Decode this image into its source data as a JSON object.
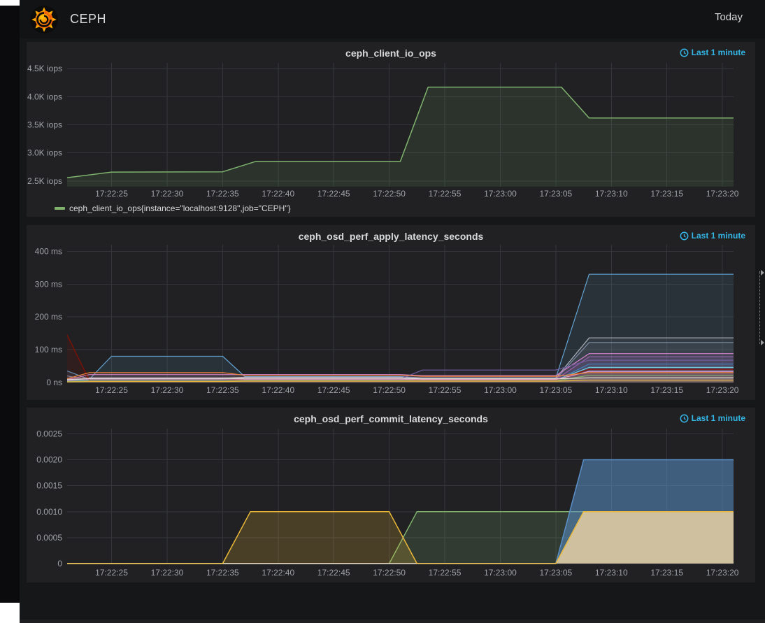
{
  "header": {
    "title": "CEPH",
    "time_picker": "Today"
  },
  "panels": [
    {
      "title": "ceph_client_io_ops",
      "time_range": "Last 1 minute"
    },
    {
      "title": "ceph_osd_perf_apply_latency_seconds",
      "time_range": "Last 1 minute"
    },
    {
      "title": "ceph_osd_perf_commit_latency_seconds",
      "time_range": "Last 1 minute"
    }
  ],
  "colors": {
    "accent_blue": "#33b5e5",
    "panel_bg": "#212124",
    "page_bg": "#161719",
    "series_green": "#7EB26D"
  },
  "chart_data": [
    {
      "type": "area",
      "title": "ceph_client_io_ops",
      "xlabel": "time",
      "ylabel": "iops",
      "xlim": [
        21,
        81
      ],
      "ylim": [
        2400,
        4600
      ],
      "grid": true,
      "legend_position": "bottom-left",
      "xticks": [
        {
          "v": 25,
          "label": "17:22:25"
        },
        {
          "v": 30,
          "label": "17:22:30"
        },
        {
          "v": 35,
          "label": "17:22:35"
        },
        {
          "v": 40,
          "label": "17:22:40"
        },
        {
          "v": 45,
          "label": "17:22:45"
        },
        {
          "v": 50,
          "label": "17:22:50"
        },
        {
          "v": 55,
          "label": "17:22:55"
        },
        {
          "v": 60,
          "label": "17:23:00"
        },
        {
          "v": 65,
          "label": "17:23:05"
        },
        {
          "v": 70,
          "label": "17:23:10"
        },
        {
          "v": 75,
          "label": "17:23:15"
        },
        {
          "v": 80,
          "label": "17:23:20"
        }
      ],
      "yticks": [
        {
          "v": 2500,
          "label": "2.5K iops"
        },
        {
          "v": 3000,
          "label": "3.0K iops"
        },
        {
          "v": 3500,
          "label": "3.5K iops"
        },
        {
          "v": 4000,
          "label": "4.0K iops"
        },
        {
          "v": 4500,
          "label": "4.5K iops"
        }
      ],
      "series": [
        {
          "name": "ceph_client_io_ops{instance=\"localhost:9128\",job=\"CEPH\"}",
          "color": "#7EB26D",
          "fill_opacity": 0.12,
          "points": [
            [
              21,
              2560
            ],
            [
              25,
              2660
            ],
            [
              35,
              2665
            ],
            [
              38,
              2850
            ],
            [
              51,
              2850
            ],
            [
              53.5,
              4170
            ],
            [
              65.5,
              4170
            ],
            [
              68,
              3620
            ],
            [
              81,
              3620
            ]
          ]
        }
      ]
    },
    {
      "type": "area",
      "title": "ceph_osd_perf_apply_latency_seconds",
      "xlabel": "time",
      "ylabel": "latency",
      "xlim": [
        21,
        81
      ],
      "ylim": [
        0,
        420
      ],
      "grid": true,
      "xticks": [
        {
          "v": 25,
          "label": "17:22:25"
        },
        {
          "v": 30,
          "label": "17:22:30"
        },
        {
          "v": 35,
          "label": "17:22:35"
        },
        {
          "v": 40,
          "label": "17:22:40"
        },
        {
          "v": 45,
          "label": "17:22:45"
        },
        {
          "v": 50,
          "label": "17:22:50"
        },
        {
          "v": 55,
          "label": "17:22:55"
        },
        {
          "v": 60,
          "label": "17:23:00"
        },
        {
          "v": 65,
          "label": "17:23:05"
        },
        {
          "v": 70,
          "label": "17:23:10"
        },
        {
          "v": 75,
          "label": "17:23:15"
        },
        {
          "v": 80,
          "label": "17:23:20"
        }
      ],
      "yticks": [
        {
          "v": 0,
          "label": "0 ns"
        },
        {
          "v": 100,
          "label": "100 ms"
        },
        {
          "v": 200,
          "label": "200 ms"
        },
        {
          "v": 300,
          "label": "300 ms"
        },
        {
          "v": 400,
          "label": "400 ms"
        }
      ],
      "x": [
        21,
        23,
        25,
        35,
        37,
        51,
        53,
        65,
        68,
        81
      ],
      "series": [
        {
          "color": "#61A3D2",
          "fill_opacity": 0.12,
          "values": [
            35,
            10,
            80,
            80,
            18,
            18,
            14,
            14,
            330,
            330
          ]
        },
        {
          "color": "#AEB4BF",
          "fill_opacity": 0.08,
          "values": [
            12,
            14,
            14,
            14,
            16,
            16,
            13,
            13,
            136,
            136
          ]
        },
        {
          "color": "#7D8CA3",
          "fill_opacity": 0.08,
          "values": [
            20,
            8,
            8,
            8,
            12,
            12,
            10,
            10,
            122,
            122
          ]
        },
        {
          "color": "#D683CE",
          "fill_opacity": 0.08,
          "values": [
            8,
            24,
            24,
            24,
            24,
            24,
            21,
            21,
            88,
            88
          ]
        },
        {
          "color": "#9A60B0",
          "fill_opacity": 0.08,
          "values": [
            5,
            7,
            7,
            7,
            10,
            10,
            9,
            9,
            78,
            78
          ]
        },
        {
          "color": "#705DA0",
          "fill_opacity": 0.08,
          "values": [
            6,
            9,
            9,
            9,
            11,
            11,
            38,
            38,
            68,
            68
          ]
        },
        {
          "color": "#447EBC",
          "fill_opacity": 0.08,
          "values": [
            10,
            5,
            5,
            5,
            7,
            7,
            6,
            6,
            56,
            56
          ]
        },
        {
          "color": "#6ED0E0",
          "fill_opacity": 0.08,
          "values": [
            4,
            6,
            6,
            6,
            8,
            8,
            7,
            7,
            46,
            46
          ]
        },
        {
          "color": "#890F02",
          "fill_opacity": 0.15,
          "values": [
            145,
            6,
            6,
            6,
            9,
            9,
            7,
            7,
            40,
            40
          ]
        },
        {
          "color": "#E5A8E2",
          "fill_opacity": 0.08,
          "values": [
            7,
            12,
            12,
            12,
            10,
            10,
            9,
            9,
            34,
            34
          ]
        },
        {
          "color": "#EF843C",
          "fill_opacity": 0.08,
          "values": [
            12,
            30,
            30,
            30,
            22,
            22,
            19,
            19,
            30,
            30
          ]
        },
        {
          "color": "#7EB26D",
          "fill_opacity": 0.08,
          "values": [
            3,
            5,
            5,
            5,
            6,
            6,
            5,
            5,
            22,
            22
          ]
        },
        {
          "color": "#E0DCD2",
          "fill_opacity": 0.08,
          "values": [
            9,
            11,
            11,
            11,
            13,
            13,
            11,
            11,
            14,
            14
          ]
        },
        {
          "color": "#EAB839",
          "fill_opacity": 0.08,
          "values": [
            2,
            3,
            3,
            3,
            4,
            4,
            4,
            4,
            7,
            7
          ]
        }
      ]
    },
    {
      "type": "area",
      "title": "ceph_osd_perf_commit_latency_seconds",
      "xlabel": "time",
      "ylabel": "seconds",
      "xlim": [
        21,
        81
      ],
      "ylim": [
        0,
        0.0026
      ],
      "grid": true,
      "xticks": [
        {
          "v": 25,
          "label": "17:22:25"
        },
        {
          "v": 30,
          "label": "17:22:30"
        },
        {
          "v": 35,
          "label": "17:22:35"
        },
        {
          "v": 40,
          "label": "17:22:40"
        },
        {
          "v": 45,
          "label": "17:22:45"
        },
        {
          "v": 50,
          "label": "17:22:50"
        },
        {
          "v": 55,
          "label": "17:22:55"
        },
        {
          "v": 60,
          "label": "17:23:00"
        },
        {
          "v": 65,
          "label": "17:23:05"
        },
        {
          "v": 70,
          "label": "17:23:10"
        },
        {
          "v": 75,
          "label": "17:23:15"
        },
        {
          "v": 80,
          "label": "17:23:20"
        }
      ],
      "yticks": [
        {
          "v": 0,
          "label": "0"
        },
        {
          "v": 0.0005,
          "label": "0.0005"
        },
        {
          "v": 0.001,
          "label": "0.0010"
        },
        {
          "v": 0.0015,
          "label": "0.0015"
        },
        {
          "v": 0.002,
          "label": "0.0020"
        },
        {
          "v": 0.0025,
          "label": "0.0025"
        }
      ],
      "series": [
        {
          "color": "#7EB26D",
          "fill_opacity": 0.18,
          "points": [
            [
              21,
              0
            ],
            [
              50,
              0
            ],
            [
              52.5,
              0.001
            ],
            [
              81,
              0.001
            ]
          ]
        },
        {
          "color": "#5A8FC7",
          "fill_opacity": 0.55,
          "points": [
            [
              21,
              0
            ],
            [
              65,
              0
            ],
            [
              67.5,
              0.002
            ],
            [
              81,
              0.002
            ]
          ]
        },
        {
          "color": "#E8D8C8",
          "fill_opacity": 0.8,
          "points": [
            [
              21,
              0
            ],
            [
              65,
              0
            ],
            [
              67.5,
              0.001
            ],
            [
              81,
              0.001
            ]
          ]
        },
        {
          "color": "#EAB839",
          "fill_opacity": 0.2,
          "points": [
            [
              21,
              0
            ],
            [
              35,
              0
            ],
            [
              37.5,
              0.001
            ],
            [
              50,
              0.001
            ],
            [
              52.5,
              0
            ],
            [
              65,
              0
            ],
            [
              67.5,
              0.001
            ],
            [
              81,
              0.001
            ]
          ]
        }
      ]
    }
  ]
}
